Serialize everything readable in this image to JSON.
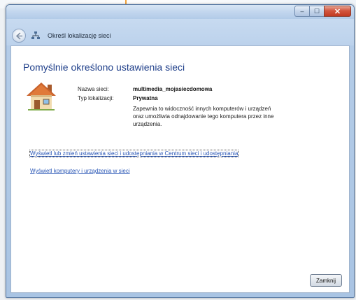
{
  "window": {
    "nav_title": "Określ lokalizację sieci"
  },
  "titlebar": {
    "minimize_glyph": "–",
    "maximize_glyph": "☐",
    "close_glyph": "✕"
  },
  "main": {
    "heading": "Pomyślnie określono ustawienia sieci",
    "network_name_label": "Nazwa sieci:",
    "network_name_value": "multimedia_mojasiecdomowa",
    "location_type_label": "Typ lokalizacji:",
    "location_type_value": "Prywatna",
    "location_description": "Zapewnia to widoczność innych komputerów i urządzeń oraz umożliwia odnajdowanie tego komputera przez inne urządzenia.",
    "link_network_center": "Wyświetl lub zmień ustawienia sieci i udostępniania w Centrum sieci i udostępniania",
    "link_view_computers": "Wyświetl komputery i urządzenia w sieci"
  },
  "footer": {
    "close_label": "Zamknij"
  },
  "colors": {
    "heading": "#1f3f8a",
    "link": "#2a57b6",
    "close_button": "#c23a22"
  },
  "icons": {
    "back": "back-arrow-icon",
    "network": "network-icon",
    "home": "home-network-icon",
    "pointer": "orange-arrow-marker"
  }
}
